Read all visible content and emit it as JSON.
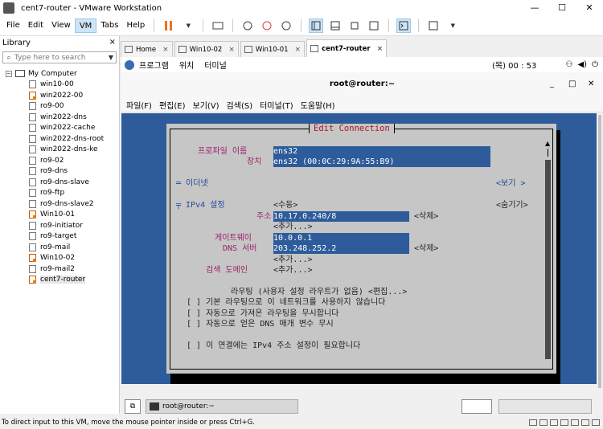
{
  "window": {
    "title": "cent7-router - VMware Workstation",
    "minimize": "—",
    "maximize": "☐",
    "close": "✕"
  },
  "menu": {
    "file": "File",
    "edit": "Edit",
    "view": "View",
    "vm": "VM",
    "tabs": "Tabs",
    "help": "Help"
  },
  "library": {
    "title": "Library",
    "close": "×",
    "search_placeholder": "Type here to search",
    "root": "My Computer",
    "items": [
      {
        "label": "win10-00",
        "on": false
      },
      {
        "label": "win2022-00",
        "on": true
      },
      {
        "label": "ro9-00",
        "on": false
      },
      {
        "label": "win2022-dns",
        "on": false
      },
      {
        "label": "win2022-cache",
        "on": false
      },
      {
        "label": "win2022-dns-root",
        "on": false
      },
      {
        "label": "win2022-dns-ke",
        "on": false
      },
      {
        "label": "ro9-02",
        "on": false
      },
      {
        "label": "ro9-dns",
        "on": false
      },
      {
        "label": "ro9-dns-slave",
        "on": false
      },
      {
        "label": "ro9-ftp",
        "on": false
      },
      {
        "label": "ro9-dns-slave2",
        "on": false
      },
      {
        "label": "Win10-01",
        "on": true
      },
      {
        "label": "ro9-initiator",
        "on": false
      },
      {
        "label": "ro9-target",
        "on": false
      },
      {
        "label": "ro9-mail",
        "on": false
      },
      {
        "label": "Win10-02",
        "on": true
      },
      {
        "label": "ro9-mail2",
        "on": false
      },
      {
        "label": "cent7-router",
        "on": true
      }
    ]
  },
  "tabs": [
    {
      "label": "Home"
    },
    {
      "label": "Win10-02"
    },
    {
      "label": "Win10-01"
    },
    {
      "label": "cent7-router"
    }
  ],
  "tab_close": "×",
  "gnome": {
    "programs": "프로그램",
    "places": "위치",
    "terminal": "터미널",
    "clock": "(목) 00 : 53"
  },
  "terminal": {
    "title": "root@router:~",
    "menu": [
      "파일(F)",
      "편집(E)",
      "보기(V)",
      "검색(S)",
      "터미널(T)",
      "도움말(H)"
    ],
    "ctl_min": "_",
    "ctl_max": "□",
    "ctl_close": "✕"
  },
  "nmtui": {
    "dialog_title": "Edit Connection",
    "profile_label": "프로파일 이름",
    "profile_value": "ens32",
    "device_label": "장치",
    "device_value": "ens32 (00:0C:29:9A:55:B9)",
    "ethernet": "═ 이더넷",
    "show": "<보기 >",
    "ipv4_label": "╤ IPv4 설정",
    "ipv4_mode": "<수동>",
    "hide": "<숨기기>",
    "address_label": "주소",
    "address_value": "10.17.0.240/8",
    "delete": "<삭제>",
    "add": "<추가...>",
    "gateway_label": "게이트웨이",
    "gateway_value": "10.0.0.1",
    "dns_label": "DNS 서버",
    "dns_value": "203.248.252.2",
    "search_label": "검색 도메인",
    "routing_line": "라우팅 (사용자 설정 라우트가 없음) <편집...>",
    "opt1": "[ ] 기본 라우팅으로 이 네트워크를 사용하지 않습니다",
    "opt2": "[ ] 자동으로 가져온 라우팅을 무시합니다",
    "opt3": "[ ] 자동으로 얻은 DNS 매개 변수 무시",
    "opt4": "[ ] 이 연결에는 IPv4 주소 설정이 필요합니다"
  },
  "statusbar": {
    "task": "root@router:~"
  },
  "footer": {
    "hint": "To direct input to this VM, move the mouse pointer inside or press Ctrl+G."
  }
}
